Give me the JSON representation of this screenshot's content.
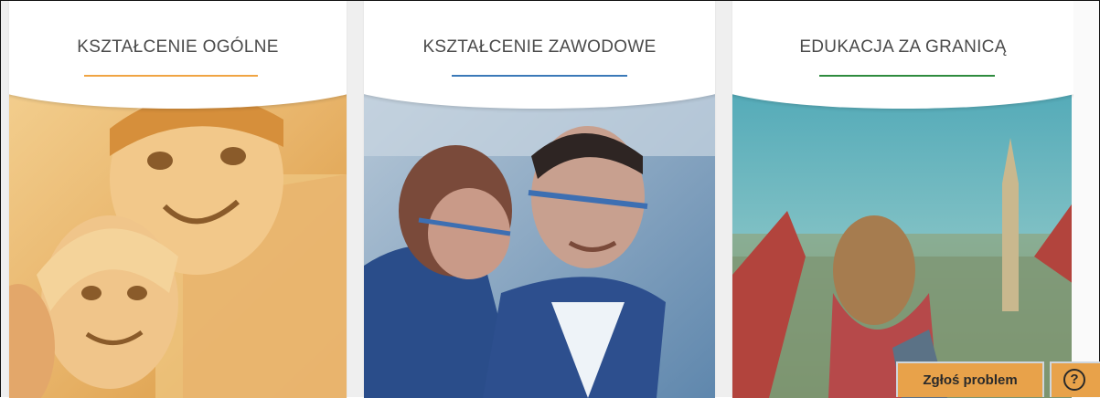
{
  "cards": [
    {
      "title": "KSZTAŁCENIE OGÓLNE",
      "accent": "#f0a443",
      "image_icon": "children-smiling"
    },
    {
      "title": "KSZTAŁCENIE ZAWODOWE",
      "accent": "#3a79b8",
      "image_icon": "workers-safety-glasses"
    },
    {
      "title": "EDUKACJA ZA GRANICĄ",
      "accent": "#2e8b3e",
      "image_icon": "student-abroad-city"
    }
  ],
  "footer": {
    "report_label": "Zgłoś problem",
    "help_label": "?",
    "accent": "#e8a24a"
  }
}
